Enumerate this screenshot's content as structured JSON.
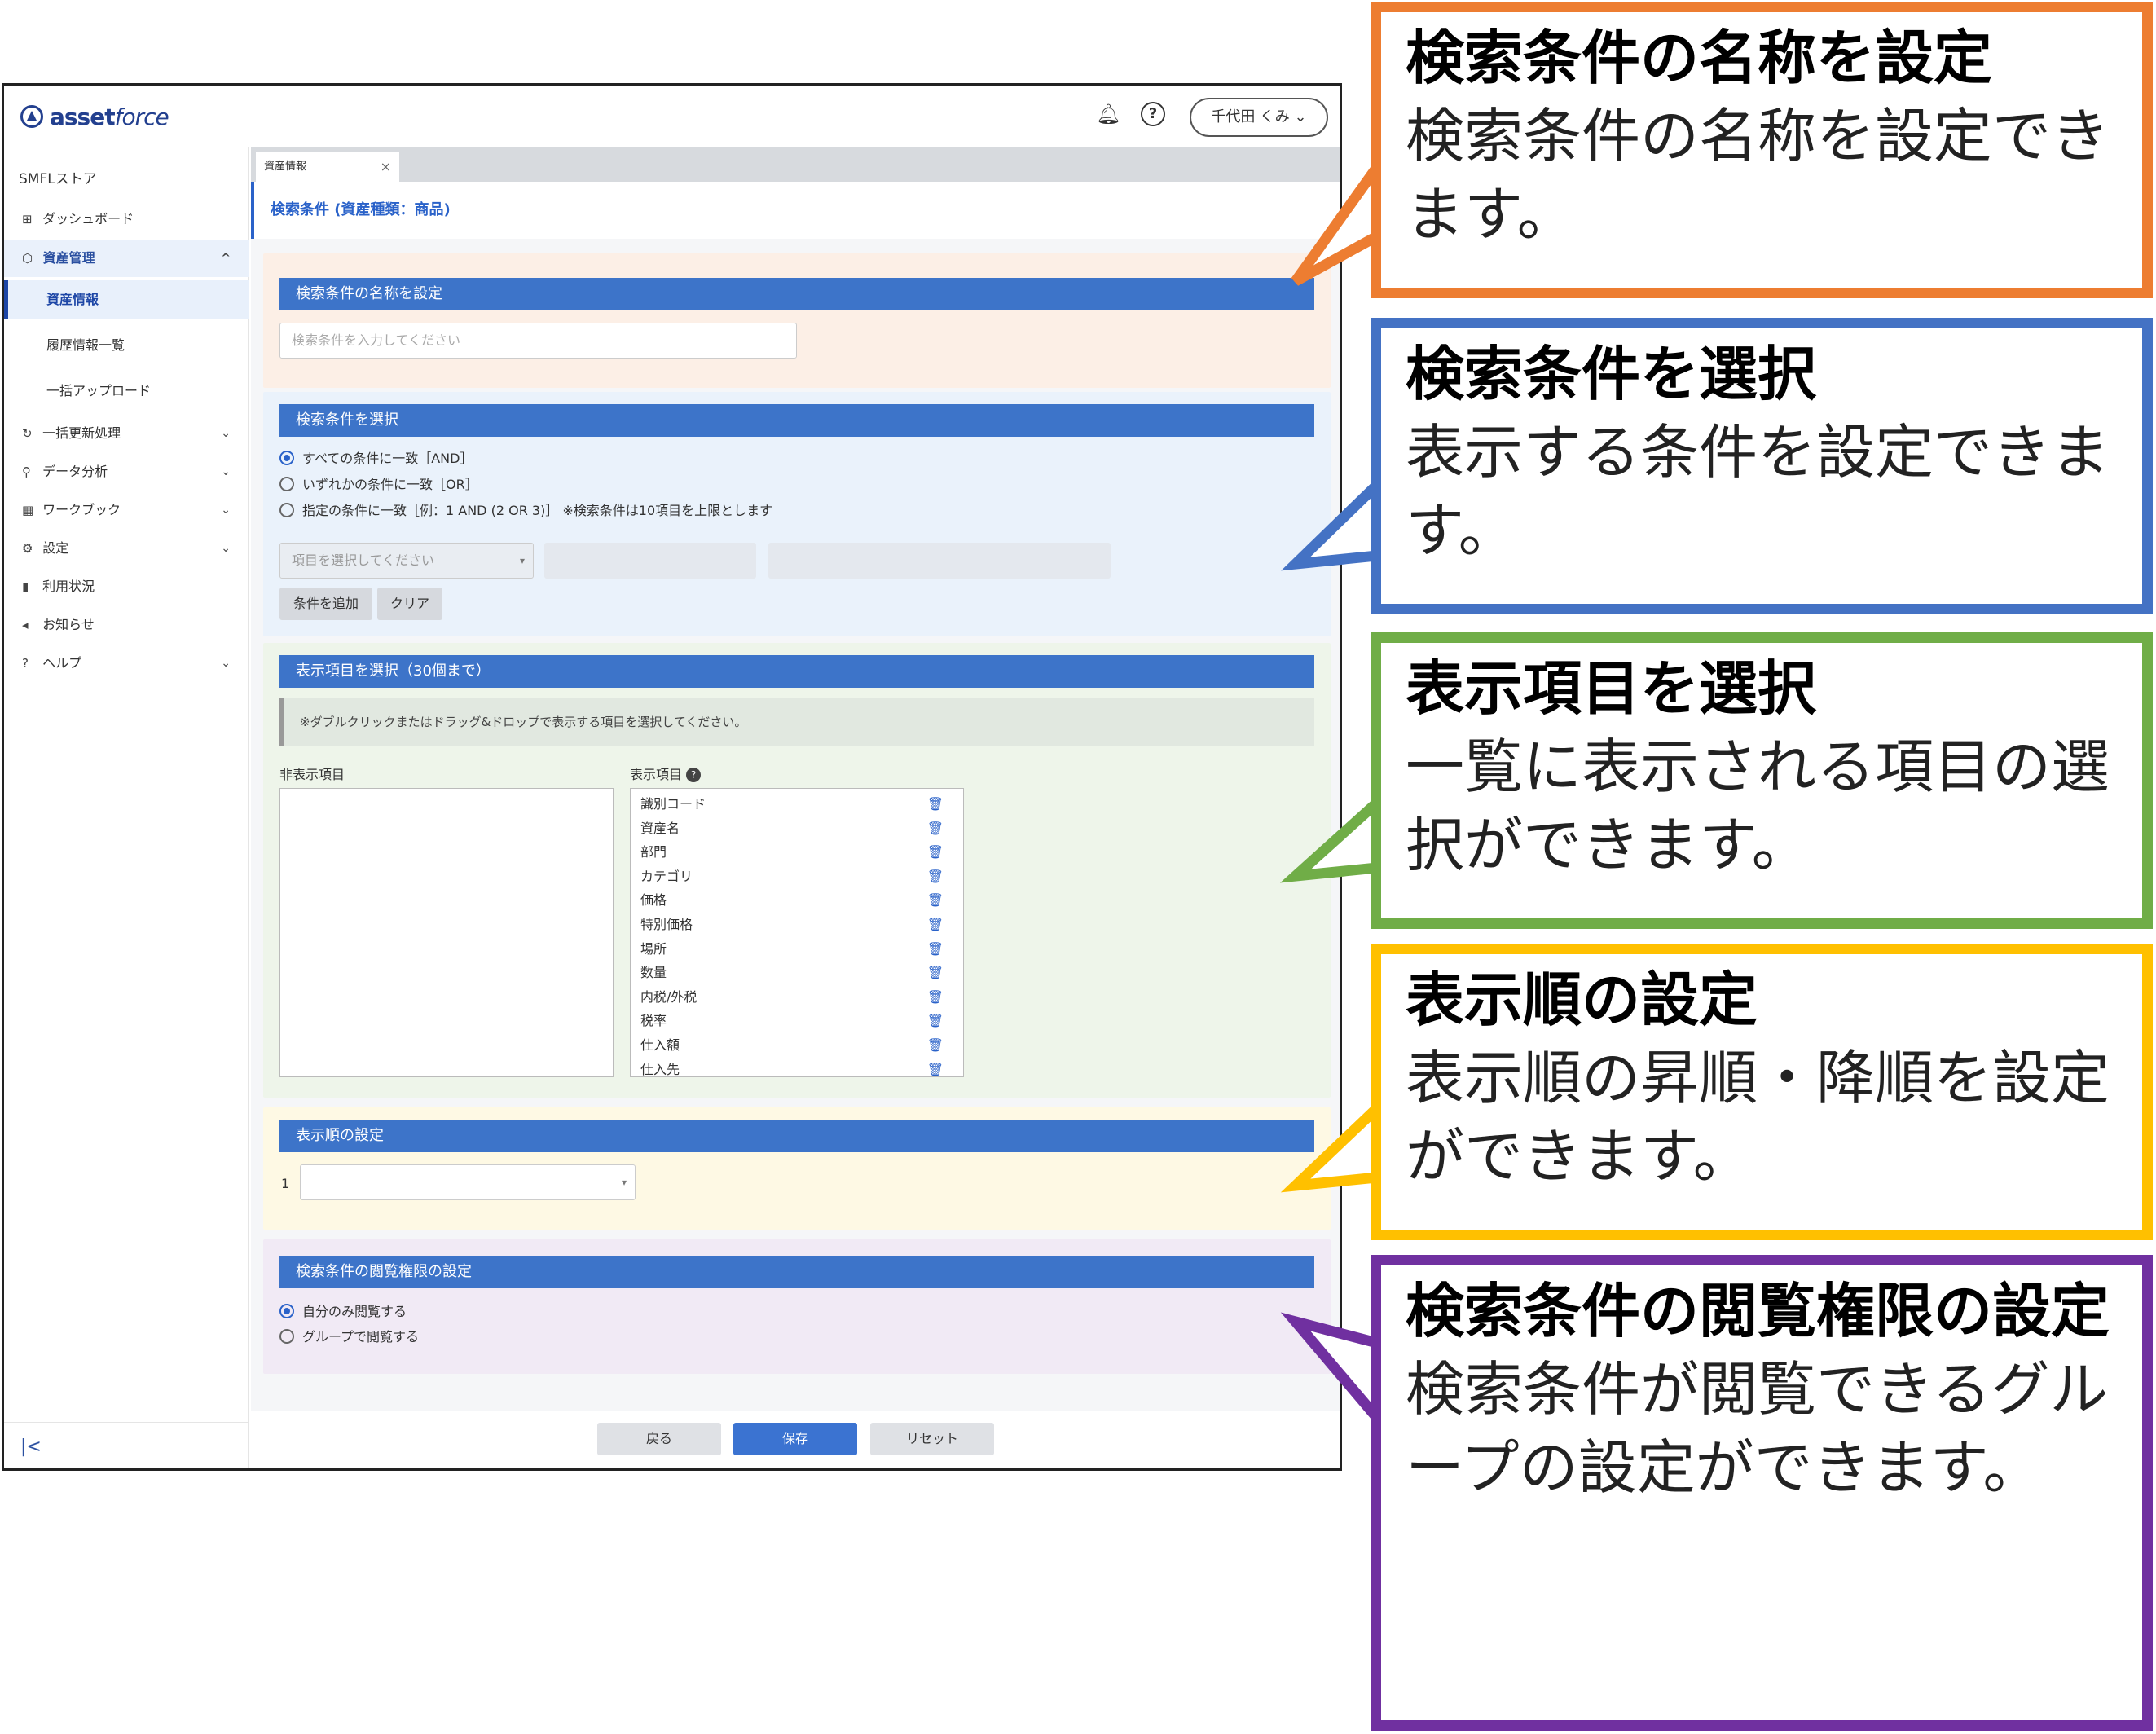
{
  "app": {
    "logo_text": "asset",
    "logo_text_italic": "force",
    "bell_icon": "bell-icon",
    "help_icon": "question-circle-icon",
    "user_label": "千代田 くみ",
    "user_caret": "⌄"
  },
  "sidebar": {
    "store_name": "SMFLストア",
    "items": [
      {
        "label": "ダッシュボード",
        "icon": "⊞"
      },
      {
        "label": "資産管理",
        "icon": "⬡",
        "chevron": "^"
      },
      {
        "label": "資産情報"
      },
      {
        "label": "履歴情報一覧"
      },
      {
        "label": "一括アップロード"
      },
      {
        "label": "一括更新処理",
        "icon": "↻",
        "chevron": "⌄"
      },
      {
        "label": "データ分析",
        "icon": "⚲",
        "chevron": "⌄"
      },
      {
        "label": "ワークブック",
        "icon": "▦",
        "chevron": "⌄"
      },
      {
        "label": "設定",
        "icon": "⚙",
        "chevron": "⌄"
      },
      {
        "label": "利用状況",
        "icon": "▮"
      },
      {
        "label": "お知らせ",
        "icon": "◂"
      },
      {
        "label": "ヘルプ",
        "icon": "?",
        "chevron": "⌄"
      }
    ],
    "collapse_icon": "|<"
  },
  "tab": {
    "label": "資産情報",
    "close": "×"
  },
  "page_title": "検索条件 (資産種類：商品)",
  "name_panel": {
    "heading": "検索条件の名称を設定",
    "placeholder": "検索条件を入力してください"
  },
  "cond_panel": {
    "heading": "検索条件を選択",
    "radios": [
      "すべての条件に一致［AND］",
      "いずれかの条件に一致［OR］",
      "指定の条件に一致［例：1 AND (2 OR 3)］ ※検索条件は10項目を上限とします"
    ],
    "select_placeholder": "項目を選択してください",
    "add_button": "条件を追加",
    "clear_button": "クリア"
  },
  "display_panel": {
    "heading": "表示項目を選択（30個まで）",
    "notice": "※ダブルクリックまたはドラッグ&ドロップで表示する項目を選択してください。",
    "hidden_label": "非表示項目",
    "shown_label": "表示項目",
    "shown_items": [
      "識別コード",
      "資産名",
      "部門",
      "カテゴリ",
      "価格",
      "特別価格",
      "場所",
      "数量",
      "内税/外税",
      "税率",
      "仕入額",
      "仕入先"
    ]
  },
  "order_panel": {
    "heading": "表示順の設定",
    "row_number": "1"
  },
  "perm_panel": {
    "heading": "検索条件の閲覧権限の設定",
    "radios": [
      "自分のみ閲覧する",
      "グループで閲覧する"
    ]
  },
  "actions": {
    "back": "戻る",
    "save": "保存",
    "reset": "リセット"
  },
  "callouts": [
    {
      "title": "検索条件の名称を設定",
      "desc": "検索条件の名称を設定できます。",
      "color": "#ed7d31"
    },
    {
      "title": "検索条件を選択",
      "desc": "表示する条件を設定できます。",
      "color": "#4472c4"
    },
    {
      "title": "表示項目を選択",
      "desc": "一覧に表示される項目の選択ができます。",
      "color": "#70ad47"
    },
    {
      "title": "表示順の設定",
      "desc": "表示順の昇順・降順を設定ができます。",
      "color": "#ffc000"
    },
    {
      "title": "検索条件の閲覧権限の設定",
      "desc": "検索条件が閲覧できるグループの設定ができます。",
      "color": "#7030a0"
    }
  ]
}
